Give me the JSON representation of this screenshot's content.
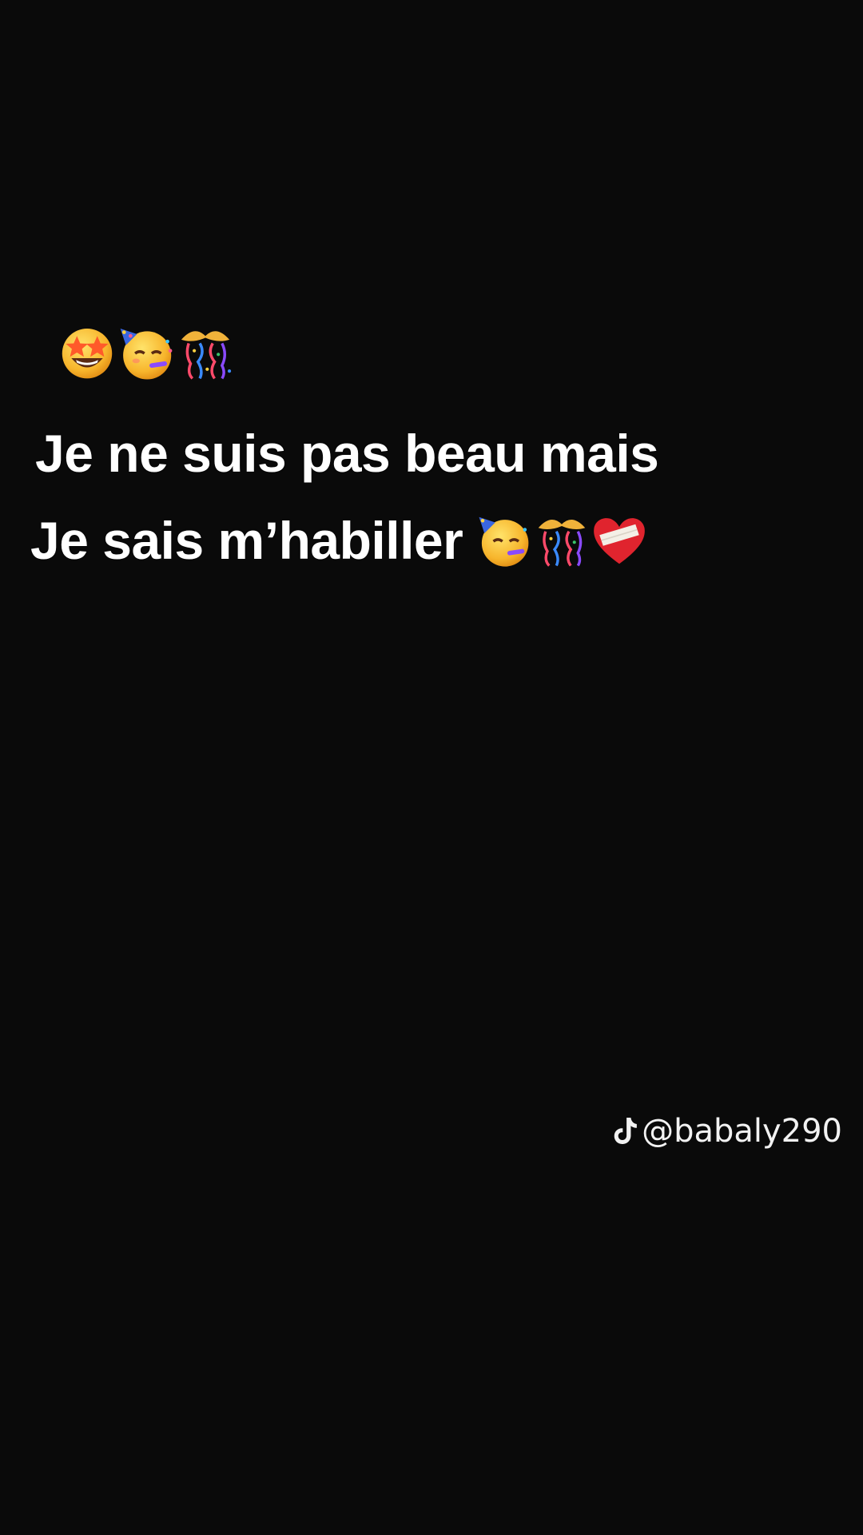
{
  "caption": {
    "emoji_row": [
      "star-struck-face",
      "partying-face",
      "confetti-ball"
    ],
    "line1": "Je ne suis pas beau mais",
    "line2": "Je sais m’habiller",
    "line2_emojis": [
      "partying-face",
      "confetti-ball",
      "mending-heart"
    ]
  },
  "watermark": {
    "icon": "tiktok-logo-icon",
    "handle": "@babaly290"
  },
  "colors": {
    "background": "#0a0a0a",
    "text": "#ffffff"
  }
}
